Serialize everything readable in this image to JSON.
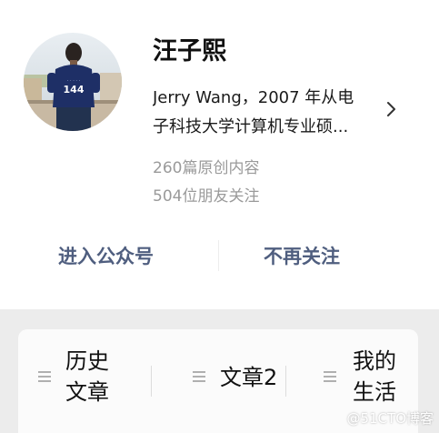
{
  "profile": {
    "name": "汪子熙",
    "bio_line1": "Jerry Wang，2007 年从电",
    "bio_line2": "子科技大学计算机专业硕...",
    "articles": "260篇原创内容",
    "friends": "504位朋友关注",
    "jersey_number": "144",
    "avatar_icon": "profile-photo",
    "detail_icon": "chevron-right-icon"
  },
  "actions": {
    "enter": "进入公众号",
    "unfollow": "不再关注"
  },
  "menu": {
    "items": [
      {
        "line1": "历史",
        "line2": "文章",
        "icon": "menu-lines-icon"
      },
      {
        "line1": "文章2",
        "line2": "",
        "icon": "menu-lines-icon"
      },
      {
        "line1": "我的",
        "line2": "生活",
        "icon": "menu-lines-icon"
      }
    ]
  },
  "watermark": "@51CTO博客",
  "colors": {
    "action_text": "#4f5e7f",
    "muted_text": "#9a9a9a",
    "page_bg": "#ececec",
    "card_bg": "#fbfbfb"
  }
}
